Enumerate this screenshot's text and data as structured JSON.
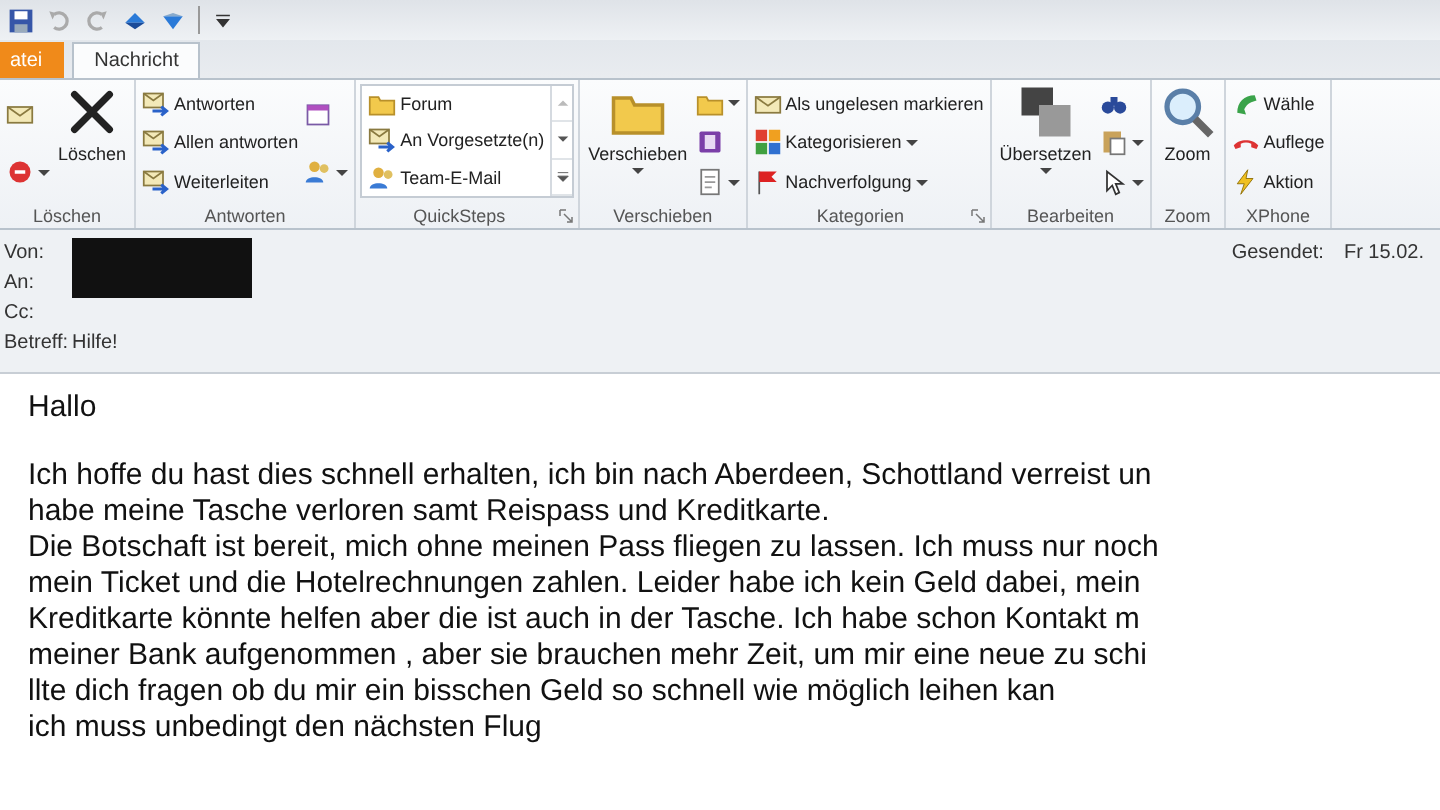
{
  "tabs": [
    {
      "label": "atei",
      "kind": "file",
      "selected": false
    },
    {
      "label": "Nachricht",
      "kind": "normal",
      "selected": true
    }
  ],
  "groups": [
    {
      "label": "Löschen",
      "launcher": false,
      "items": [
        {
          "kind": "icon",
          "dropdown": false
        },
        {
          "kind": "icon",
          "dropdown": true
        },
        {
          "kind": "large",
          "label": "Löschen",
          "dropdown": false
        }
      ]
    },
    {
      "label": "Antworten",
      "launcher": false,
      "items": [
        {
          "kind": "small",
          "label": "Antworten",
          "dropdown": false
        },
        {
          "kind": "small",
          "label": "Allen antworten",
          "dropdown": false
        },
        {
          "kind": "small",
          "label": "Weiterleiten",
          "dropdown": false
        },
        {
          "kind": "icon",
          "dropdown": false
        },
        {
          "kind": "icon",
          "dropdown": true
        }
      ]
    },
    {
      "label": "QuickSteps",
      "launcher": true,
      "items": [
        {
          "kind": "gallery",
          "entries": [
            "Forum",
            "An Vorgesetzte(n)",
            "Team-E-Mail"
          ]
        }
      ]
    },
    {
      "label": "Verschieben",
      "launcher": false,
      "items": [
        {
          "kind": "large",
          "label": "Verschieben",
          "dropdown": true
        },
        {
          "kind": "icon",
          "dropdown": true
        },
        {
          "kind": "icon",
          "dropdown": false
        },
        {
          "kind": "icon",
          "dropdown": true
        }
      ]
    },
    {
      "label": "Kategorien",
      "launcher": true,
      "items": [
        {
          "kind": "small",
          "label": "Als ungelesen markieren",
          "dropdown": false
        },
        {
          "kind": "small",
          "label": "Kategorisieren",
          "dropdown": true
        },
        {
          "kind": "small",
          "label": "Nachverfolgung",
          "dropdown": true
        }
      ]
    },
    {
      "label": "Bearbeiten",
      "launcher": false,
      "items": [
        {
          "kind": "large",
          "label": "Übersetzen",
          "dropdown": true
        },
        {
          "kind": "icon",
          "dropdown": false
        },
        {
          "kind": "icon",
          "dropdown": true
        },
        {
          "kind": "icon",
          "dropdown": true
        }
      ]
    },
    {
      "label": "Zoom",
      "launcher": false,
      "items": [
        {
          "kind": "large",
          "label": "Zoom",
          "dropdown": false
        }
      ]
    },
    {
      "label": "XPhone",
      "launcher": false,
      "items": [
        {
          "kind": "small",
          "label": "Wähle",
          "dropdown": false
        },
        {
          "kind": "small",
          "label": "Auflege",
          "dropdown": false
        },
        {
          "kind": "small",
          "label": "Aktion",
          "dropdown": false
        }
      ]
    }
  ],
  "header": {
    "fields": [
      {
        "label": "Von:"
      },
      {
        "label": "An:"
      },
      {
        "label": "Cc:"
      },
      {
        "label": "Betreff:",
        "value": "Hilfe!"
      }
    ],
    "sent": {
      "label": "Gesendet:",
      "value": "Fr 15.02."
    }
  },
  "body": {
    "greeting": "Hallo",
    "lines": [
      "Ich hoffe du hast dies schnell erhalten, ich bin nach Aberdeen, Schottland verreist un",
      "habe meine Tasche verloren samt Reispass und Kreditkarte.",
      "Die Botschaft ist bereit, mich ohne meinen Pass fliegen zu lassen. Ich muss nur noch",
      "mein Ticket und die Hotelrechnungen zahlen. Leider habe ich kein Geld dabei, mein",
      "Kreditkarte könnte helfen aber die ist auch in der Tasche. Ich habe schon Kontakt m",
      "meiner Bank aufgenommen , aber sie brauchen mehr Zeit, um mir eine neue zu schi",
      "llte dich fragen ob du mir ein bisschen Geld so schnell wie möglich leihen kan",
      "ich muss unbedingt den nächsten Flug"
    ]
  }
}
